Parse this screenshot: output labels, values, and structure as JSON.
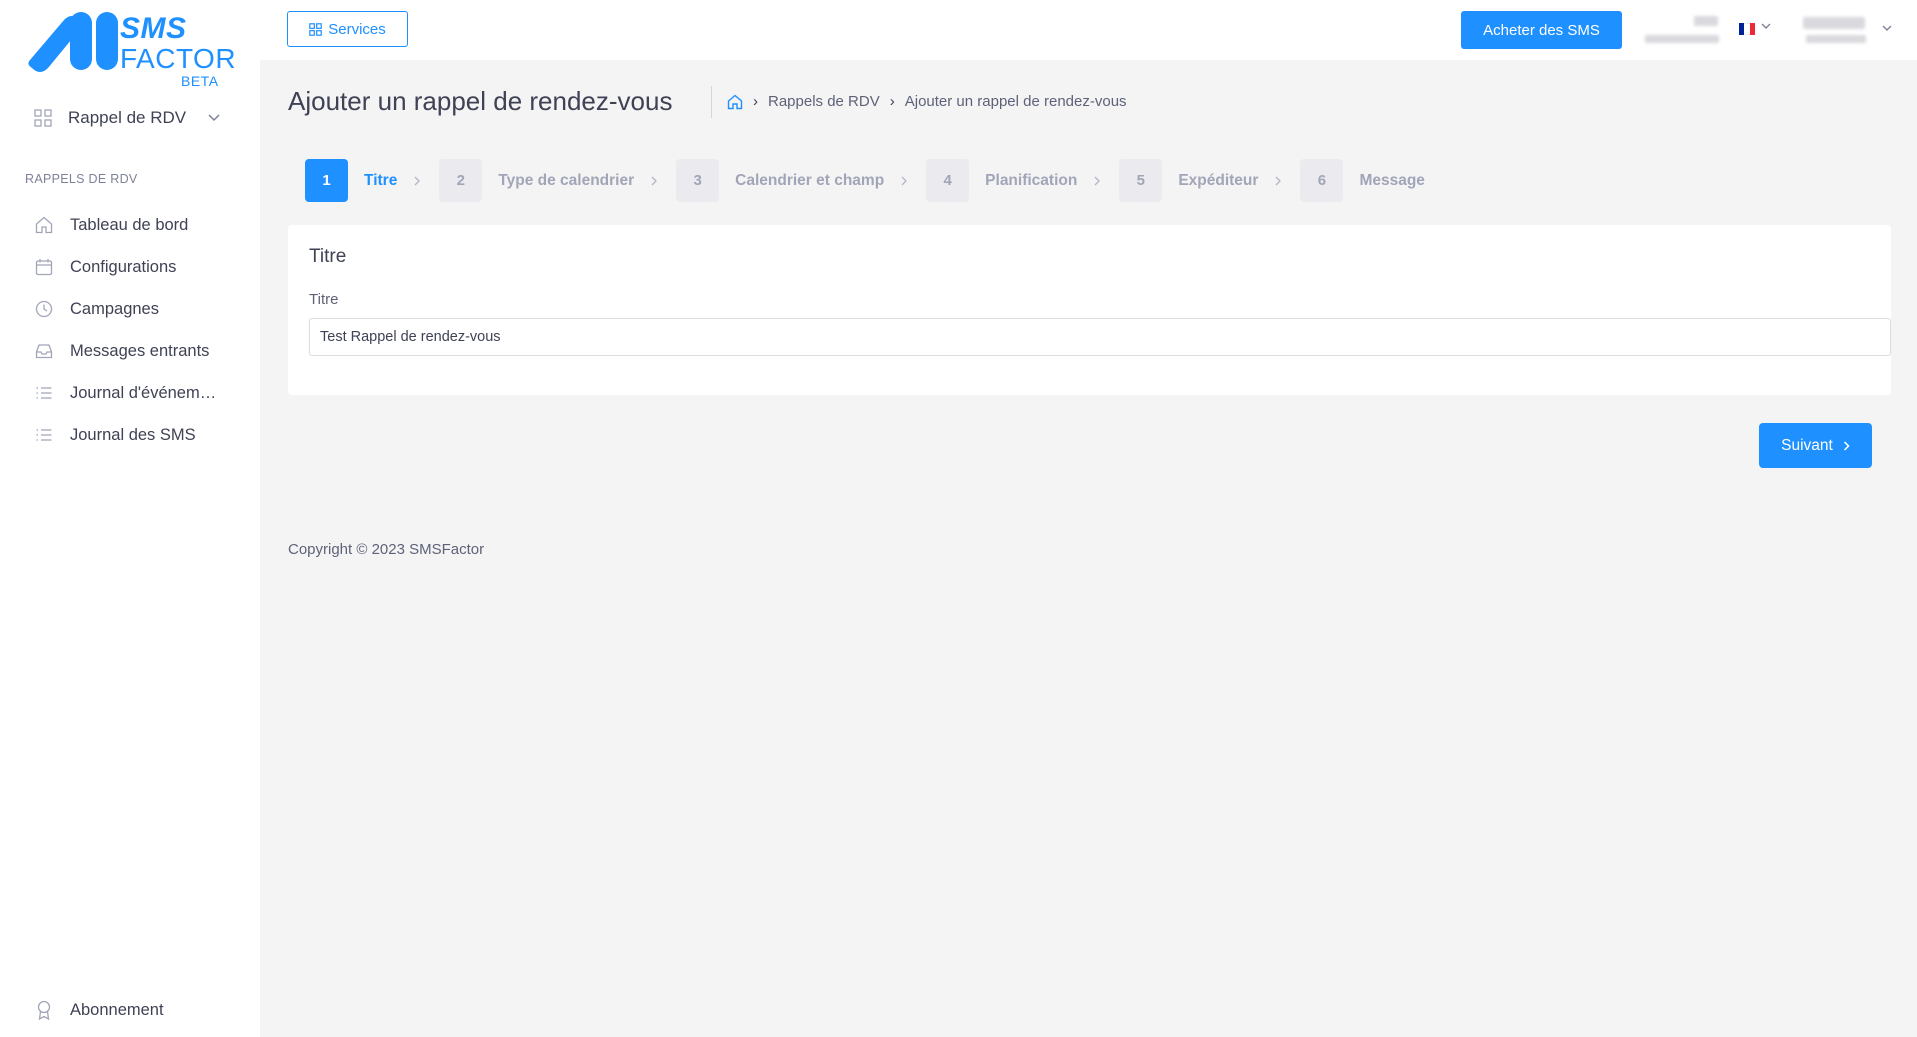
{
  "brand": {
    "line1": "SMS",
    "line2": "FACTOR",
    "badge": "BETA",
    "color": "#1e90ff"
  },
  "sidebar": {
    "module_selector": {
      "label": "Rappel de RDV",
      "icon": "grid-icon"
    },
    "section_title": "RAPPELS DE RDV",
    "items": [
      {
        "label": "Tableau de bord",
        "icon": "home-icon"
      },
      {
        "label": "Configurations",
        "icon": "calendar-icon"
      },
      {
        "label": "Campagnes",
        "icon": "clock-icon"
      },
      {
        "label": "Messages entrants",
        "icon": "inbox-icon"
      },
      {
        "label": "Journal d'événements",
        "icon": "list-icon"
      },
      {
        "label": "Journal des SMS",
        "icon": "list-icon"
      }
    ],
    "bottom_item": {
      "label": "Abonnement",
      "icon": "award-icon"
    }
  },
  "topbar": {
    "services_label": "Services",
    "buy_label": "Acheter des SMS",
    "language": "fr"
  },
  "page": {
    "title": "Ajouter un rappel de rendez-vous",
    "breadcrumb": [
      "Rappels de RDV",
      "Ajouter un rappel de rendez-vous"
    ]
  },
  "stepper": {
    "active": 1,
    "steps": [
      {
        "num": "1",
        "label": "Titre"
      },
      {
        "num": "2",
        "label": "Type de calendrier"
      },
      {
        "num": "3",
        "label": "Calendrier et champ"
      },
      {
        "num": "4",
        "label": "Planification"
      },
      {
        "num": "5",
        "label": "Expéditeur"
      },
      {
        "num": "6",
        "label": "Message"
      }
    ]
  },
  "form": {
    "card_title": "Titre",
    "field_label": "Titre",
    "field_value": "Test Rappel de rendez-vous"
  },
  "actions": {
    "next_label": "Suivant"
  },
  "footer": {
    "copyright": "Copyright © 2023 SMSFactor"
  },
  "colors": {
    "primary": "#1e90ff",
    "muted": "#a1a5b7",
    "background": "#f4f4f5"
  }
}
